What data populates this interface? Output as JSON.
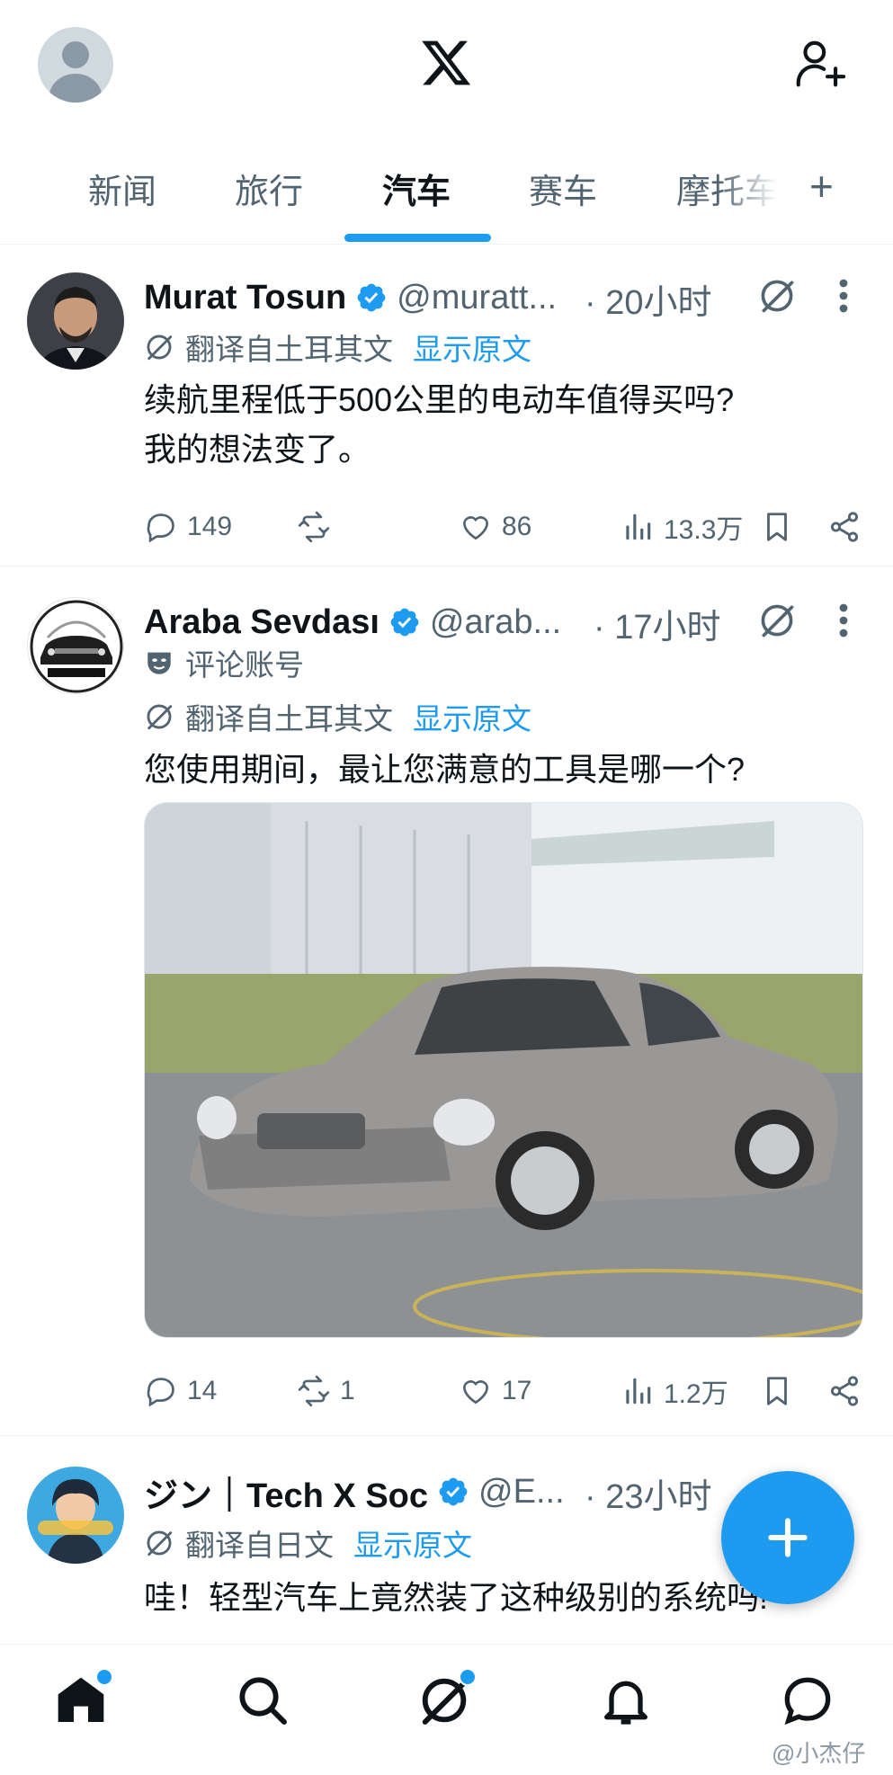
{
  "header": {
    "logo": "X"
  },
  "tabs": [
    {
      "label": "新闻"
    },
    {
      "label": "旅行"
    },
    {
      "label": "汽车",
      "active": true
    },
    {
      "label": "赛车"
    },
    {
      "label": "摩托车"
    }
  ],
  "tab_add_label": "+",
  "posts": [
    {
      "name": "Murat Tosun",
      "handle": "@muratt...",
      "time": "· 20小时",
      "translation": "翻译自土耳其文",
      "show_original": "显示原文",
      "text_lines": [
        "续航里程低于500公里的电动车值得买吗?",
        "我的想法变了。"
      ],
      "replies": "149",
      "reposts": "",
      "likes": "86",
      "views": "13.3万"
    },
    {
      "name": "Araba Sevdası",
      "handle": "@arab...",
      "time": "· 17小时",
      "label": "评论账号",
      "translation": "翻译自土耳其文",
      "show_original": "显示原文",
      "text_lines": [
        "您使用期间，最让您满意的工具是哪一个?"
      ],
      "replies": "14",
      "reposts": "1",
      "likes": "17",
      "views": "1.2万"
    },
    {
      "name": "ジン｜Tech X Soc",
      "handle": "@E...",
      "time": "· 23小时",
      "translation": "翻译自日文",
      "show_original": "显示原文",
      "text_lines": [
        "哇！轻型汽车上竟然装了这种级别的系统吗!"
      ]
    }
  ],
  "watermark": "@小杰仔",
  "colors": {
    "accent": "#1d9bf0",
    "text": "#0f1419",
    "muted": "#536471"
  }
}
